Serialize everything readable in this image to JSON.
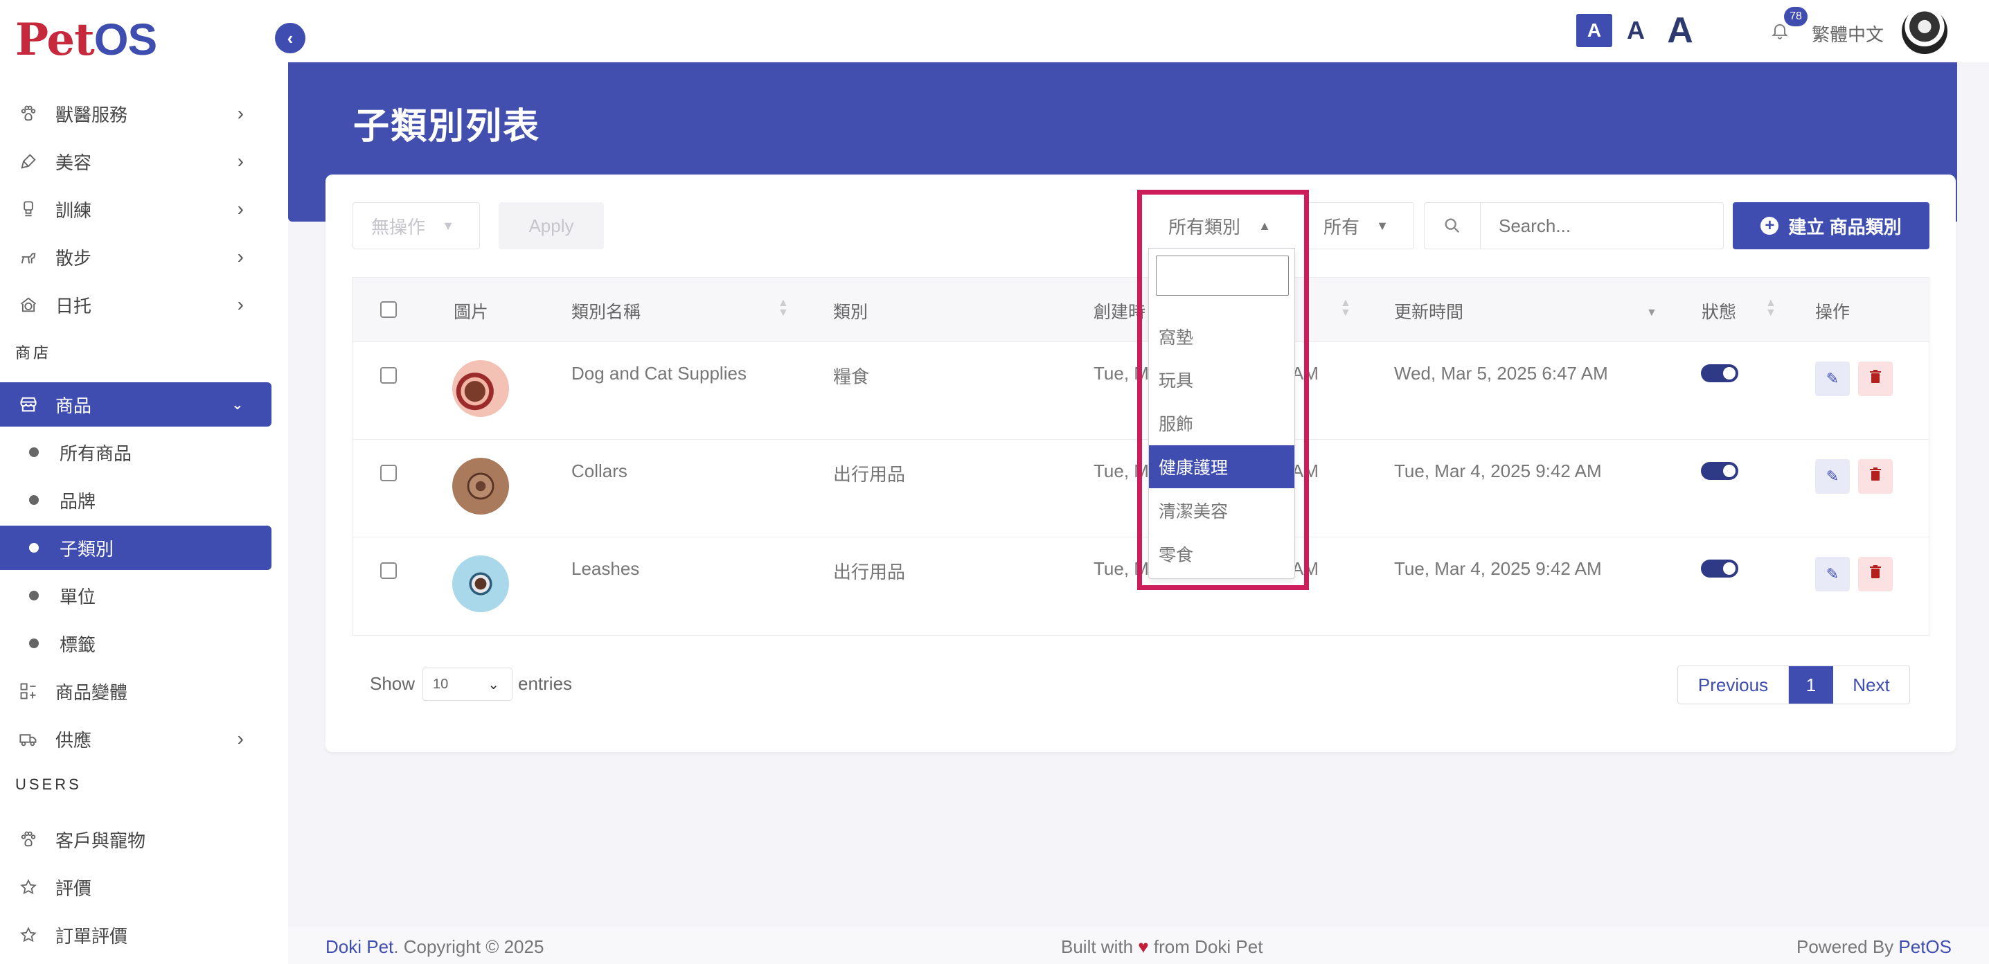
{
  "app": {
    "logo": "PetOS",
    "collapse_icon": "chevron-left-icon"
  },
  "sidebar": {
    "items": [
      {
        "label": "獸醫服務",
        "icon": "paw-icon"
      },
      {
        "label": "美容",
        "icon": "brush-icon"
      },
      {
        "label": "訓練",
        "icon": "trophy-icon"
      },
      {
        "label": "散步",
        "icon": "dog-walk-icon"
      },
      {
        "label": "日托",
        "icon": "daycare-icon"
      }
    ],
    "shop_section": "商店",
    "products": {
      "label": "商品",
      "icon": "store-icon"
    },
    "product_sub": [
      "所有商品",
      "品牌",
      "子類別",
      "單位",
      "標籤"
    ],
    "variants": {
      "label": "商品變體",
      "icon": "variants-icon"
    },
    "supply": {
      "label": "供應",
      "icon": "truck-icon"
    },
    "users_section": "USERS",
    "customers": {
      "label": "客戶與寵物",
      "icon": "paw-icon"
    },
    "reviews": {
      "label": "評價",
      "icon": "star-icon"
    },
    "order_reviews": {
      "label": "訂單評價",
      "icon": "star-icon"
    }
  },
  "topbar": {
    "font_small": "A",
    "font_medium": "A",
    "font_large": "A",
    "notification_count": "78",
    "language": "繁體中文"
  },
  "page": {
    "title": "子類別列表"
  },
  "toolbar": {
    "bulk_action": "無操作",
    "apply": "Apply",
    "category_filter": "所有類別",
    "status_filter": "所有",
    "search_placeholder": "Search...",
    "create": "建立 商品類別"
  },
  "dropdown": {
    "options": [
      "窩墊",
      "玩具",
      "服飾",
      "健康護理",
      "清潔美容",
      "零食"
    ],
    "selected": "健康護理"
  },
  "table": {
    "headers": {
      "image": "圖片",
      "name": "類別名稱",
      "category": "類別",
      "created": "創建時",
      "updated": "更新時間",
      "status": "狀態",
      "actions": "操作"
    },
    "rows": [
      {
        "name": "Dog and Cat Supplies",
        "category": "糧食",
        "created": "Tue, M",
        "created_tail": "AM",
        "updated": "Wed, Mar 5, 2025 6:47 AM",
        "status": true
      },
      {
        "name": "Collars",
        "category": "出行用品",
        "created": "Tue, M",
        "created_tail": "AM",
        "updated": "Tue, Mar 4, 2025 9:42 AM",
        "status": true
      },
      {
        "name": "Leashes",
        "category": "出行用品",
        "created": "Tue, M",
        "created_tail": "AM",
        "updated": "Tue, Mar 4, 2025 9:42 AM",
        "status": true
      }
    ]
  },
  "pagination": {
    "show": "Show",
    "per_page": "10",
    "entries": "entries",
    "previous": "Previous",
    "current": "1",
    "next": "Next"
  },
  "footer": {
    "brand": "Doki Pet",
    "copyright": ". Copyright © 2025",
    "built_prefix": "Built with ",
    "built_suffix": " from Doki Pet",
    "powered_prefix": "Powered By ",
    "powered_brand": "PetOS"
  },
  "colors": {
    "primary": "#3f4db1",
    "highlight": "#cc1c5a",
    "delete": "#b3201e"
  }
}
